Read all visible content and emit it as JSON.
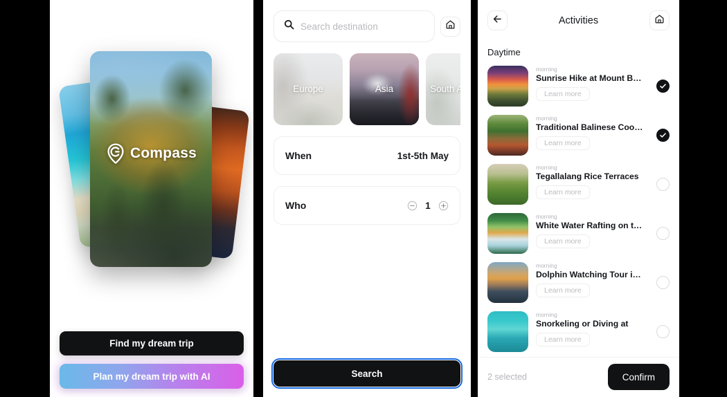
{
  "onboarding": {
    "brand_name": "Compass",
    "brand_icon": "map-pin-c-logo",
    "cards": [
      {
        "id": "beach-card",
        "alt": "tropical beach"
      },
      {
        "id": "temple-card",
        "alt": "golden temple by pond"
      },
      {
        "id": "sunset-card",
        "alt": "orange sunset street"
      }
    ],
    "primary_cta": "Find my dream trip",
    "secondary_cta": "Plan my dream trip with AI",
    "secondary_gradient_from": "#6ab9e9",
    "secondary_gradient_to": "#da5fe8"
  },
  "search": {
    "placeholder": "Search destination",
    "search_icon": "search-icon",
    "home_icon": "home-icon",
    "destinations": [
      {
        "label": "Europe",
        "selected": false
      },
      {
        "label": "Asia",
        "selected": true
      },
      {
        "label": "South America",
        "selected": false
      }
    ],
    "when": {
      "label": "When",
      "value": "1st-5th May"
    },
    "who": {
      "label": "Who",
      "value": "1",
      "minus_icon": "minus-circle-icon",
      "plus_icon": "plus-circle-icon"
    },
    "submit_label": "Search",
    "submit_focus_color": "#1769e0"
  },
  "activities": {
    "back_icon": "arrow-left-icon",
    "home_icon": "home-icon",
    "title": "Activities",
    "section": "Daytime",
    "learn_more_label": "Learn more",
    "items": [
      {
        "time": "morning",
        "name": "Sunrise Hike at Mount Batur",
        "selected": true,
        "thumb": "t1"
      },
      {
        "time": "morning",
        "name": "Traditional Balinese Cooking...",
        "selected": true,
        "thumb": "t2"
      },
      {
        "time": "morning",
        "name": "Tegallalang Rice Terraces",
        "selected": false,
        "thumb": "t3"
      },
      {
        "time": "morning",
        "name": "White Water Rafting on the...",
        "selected": false,
        "thumb": "t4"
      },
      {
        "time": "morning",
        "name": "Dolphin Watching Tour in Lovina",
        "selected": false,
        "thumb": "t5"
      },
      {
        "time": "morning",
        "name": "Snorkeling or Diving at",
        "selected": false,
        "thumb": "t6"
      }
    ],
    "selected_count_label": "2 selected",
    "confirm_label": "Confirm"
  }
}
